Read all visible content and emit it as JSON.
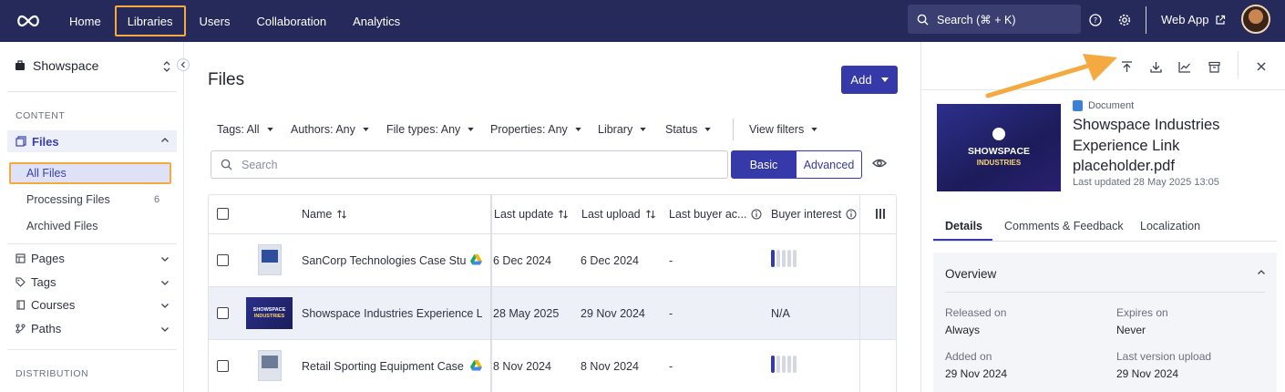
{
  "topnav": {
    "links": [
      "Home",
      "Libraries",
      "Users",
      "Collaboration",
      "Analytics"
    ],
    "active": "Libraries",
    "search_label": "Search (⌘ + K)",
    "web_app": "Web App"
  },
  "sidebar": {
    "workspace": "Showspace",
    "content_label": "CONTENT",
    "files_label": "Files",
    "sub_items": [
      {
        "label": "All Files"
      },
      {
        "label": "Processing Files",
        "count": "6"
      },
      {
        "label": "Archived Files"
      }
    ],
    "nav_items": [
      "Pages",
      "Tags",
      "Courses",
      "Paths"
    ],
    "distribution_label": "DISTRIBUTION"
  },
  "main": {
    "title": "Files",
    "add_label": "Add",
    "filters": [
      "Tags: All",
      "Authors: Any",
      "File types: Any",
      "Properties: Any",
      "Library",
      "Status",
      "View filters"
    ],
    "search_placeholder": "Search",
    "toggle": {
      "basic": "Basic",
      "advanced": "Advanced"
    },
    "columns": [
      "Name",
      "Last update",
      "Last upload",
      "Last buyer ac...",
      "Buyer interest"
    ],
    "rows": [
      {
        "name": "SanCorp Technologies Case Stu...",
        "last_update": "6 Dec 2024",
        "last_upload": "6 Dec 2024",
        "last_buyer": "-",
        "interest": "",
        "interest_level": 1
      },
      {
        "name": "Showspace Industries Experience L...",
        "last_update": "28 May 2025",
        "last_upload": "29 Nov 2024",
        "last_buyer": "-",
        "interest": "N/A",
        "interest_level": 0
      },
      {
        "name": "Retail Sporting Equipment Case ...",
        "last_update": "8 Nov 2024",
        "last_upload": "8 Nov 2024",
        "last_buyer": "-",
        "interest": "",
        "interest_level": 1
      }
    ],
    "thumb_text": [
      "SHOWSPACE",
      "INDUSTRIES"
    ]
  },
  "panel": {
    "doc_type": "Document",
    "title": "Showspace Industries Experience Link placeholder.pdf",
    "updated": "Last updated 28 May 2025 13:05",
    "thumb_text": [
      "SHOWSPACE",
      "INDUSTRIES"
    ],
    "tabs": [
      "Details",
      "Comments & Feedback",
      "Localization"
    ],
    "overview": {
      "title": "Overview",
      "fields": [
        {
          "k": "Released on",
          "v": "Always"
        },
        {
          "k": "Expires on",
          "v": "Never"
        },
        {
          "k": "Added on",
          "v": "29 Nov 2024"
        },
        {
          "k": "Last version upload",
          "v": "29 Nov 2024"
        }
      ]
    }
  },
  "colors": {
    "nav_bg": "#262a5a",
    "accent": "#3639a8",
    "highlight": "#f5a941"
  }
}
